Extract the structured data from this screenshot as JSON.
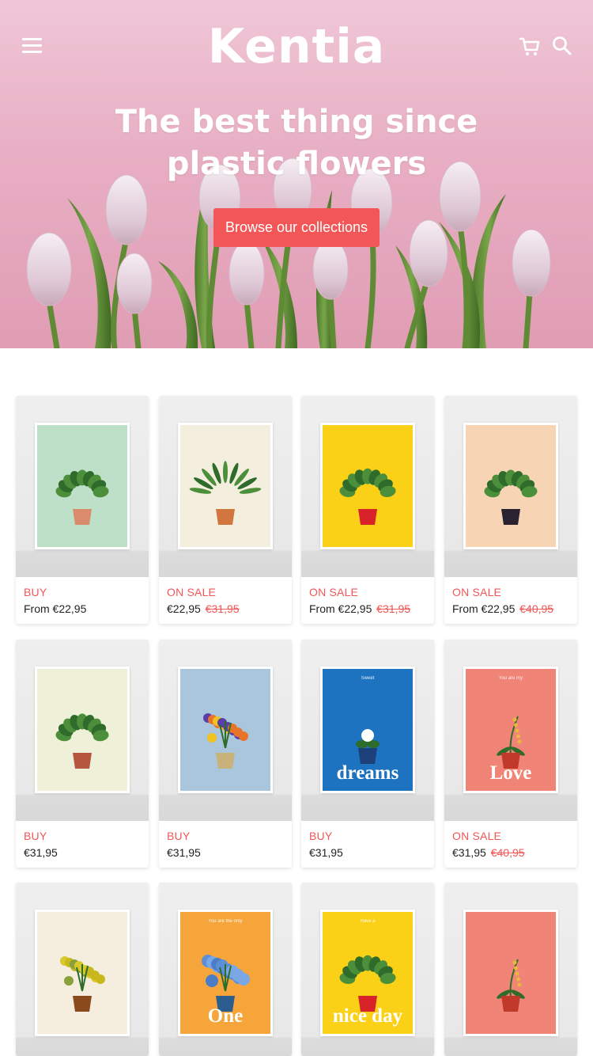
{
  "header": {
    "brand": "Kentia",
    "menu_icon": "hamburger-menu-icon",
    "cart_icon": "shopping-cart-icon",
    "search_icon": "search-icon"
  },
  "hero": {
    "headline_line1": "The best thing since",
    "headline_line2": "plastic flowers",
    "cta_label": "Browse our collections",
    "background_color": "#e8aec3"
  },
  "colors": {
    "accent": "#f25656",
    "text": "#222222",
    "white": "#ffffff"
  },
  "products": [
    {
      "tag": "BUY",
      "price": "From €22,95",
      "old_price": "",
      "poster_color": "#bfe0c8",
      "topline": "",
      "word": ""
    },
    {
      "tag": "ON SALE",
      "price": "€22,95",
      "old_price": "€31,95",
      "poster_color": "#f3eedd",
      "topline": "",
      "word": ""
    },
    {
      "tag": "ON SALE",
      "price": "From €22,95",
      "old_price": "€31,95",
      "poster_color": "#fbd117",
      "topline": "",
      "word": ""
    },
    {
      "tag": "ON SALE",
      "price": "From €22,95",
      "old_price": "€40,95",
      "poster_color": "#f7d5b4",
      "topline": "",
      "word": ""
    },
    {
      "tag": "BUY",
      "price": "€31,95",
      "old_price": "",
      "poster_color": "#eef0d8",
      "topline": "",
      "word": ""
    },
    {
      "tag": "BUY",
      "price": "€31,95",
      "old_price": "",
      "poster_color": "#a9c6dd",
      "topline": "",
      "word": ""
    },
    {
      "tag": "BUY",
      "price": "€31,95",
      "old_price": "",
      "poster_color": "#1d73c0",
      "topline": "Sweet",
      "word": "dreams"
    },
    {
      "tag": "ON SALE",
      "price": "€31,95",
      "old_price": "€40,95",
      "poster_color": "#f08476",
      "topline": "You are my",
      "word": "Love"
    },
    {
      "tag": "",
      "price": "",
      "old_price": "",
      "poster_color": "#f5eedf",
      "topline": "",
      "word": ""
    },
    {
      "tag": "",
      "price": "",
      "old_price": "",
      "poster_color": "#f6a53b",
      "topline": "You are the only",
      "word": "One"
    },
    {
      "tag": "",
      "price": "",
      "old_price": "",
      "poster_color": "#fbd117",
      "topline": "Have a",
      "word": "nice day"
    },
    {
      "tag": "",
      "price": "",
      "old_price": "",
      "poster_color": "#f08476",
      "topline": "",
      "word": ""
    }
  ]
}
